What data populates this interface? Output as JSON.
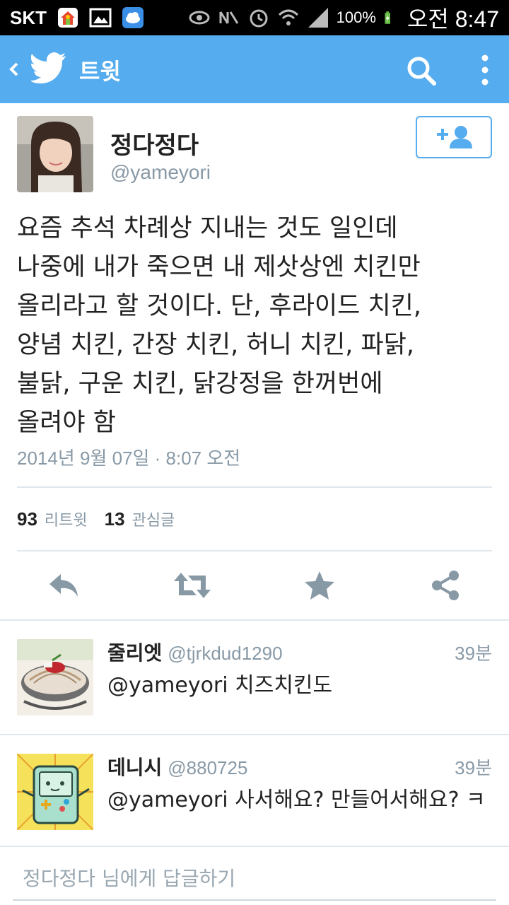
{
  "status_bar": {
    "carrier": "SKT",
    "battery_percent": "100%",
    "time": "오전 8:47"
  },
  "action_bar": {
    "title": "트윗",
    "color": "#55acee"
  },
  "tweet": {
    "author_name": "정다정다",
    "author_handle": "@yameyori",
    "text_lines": [
      "요즘 추석 차례상 지내는 것도 일인데",
      "나중에 내가 죽으면 내 제삿상엔 치킨만",
      "올리라고 할 것이다. 단, 후라이드 치킨,",
      "양념 치킨, 간장 치킨, 허니 치킨, 파닭,",
      "불닭, 구운 치킨, 닭강정을 한꺼번에",
      "올려야 함"
    ],
    "timestamp": "2014년 9월 07일 · 8:07 오전",
    "retweet_count": "93",
    "retweet_label": "리트윗",
    "favorite_count": "13",
    "favorite_label": "관심글"
  },
  "actions": {
    "icons": [
      "reply-icon",
      "retweet-icon",
      "favorite-icon",
      "share-icon"
    ]
  },
  "replies": [
    {
      "name": "줄리엣",
      "handle": "@tjrkdud1290",
      "time": "39분",
      "text": "@yameyori 치즈치킨도"
    },
    {
      "name": "데니시",
      "handle": "@880725",
      "time": "39분",
      "text": "@yameyori 사서해요? 만들어서해요? ㅋ"
    }
  ],
  "compose": {
    "placeholder": "정다정다 님에게 답글하기"
  }
}
